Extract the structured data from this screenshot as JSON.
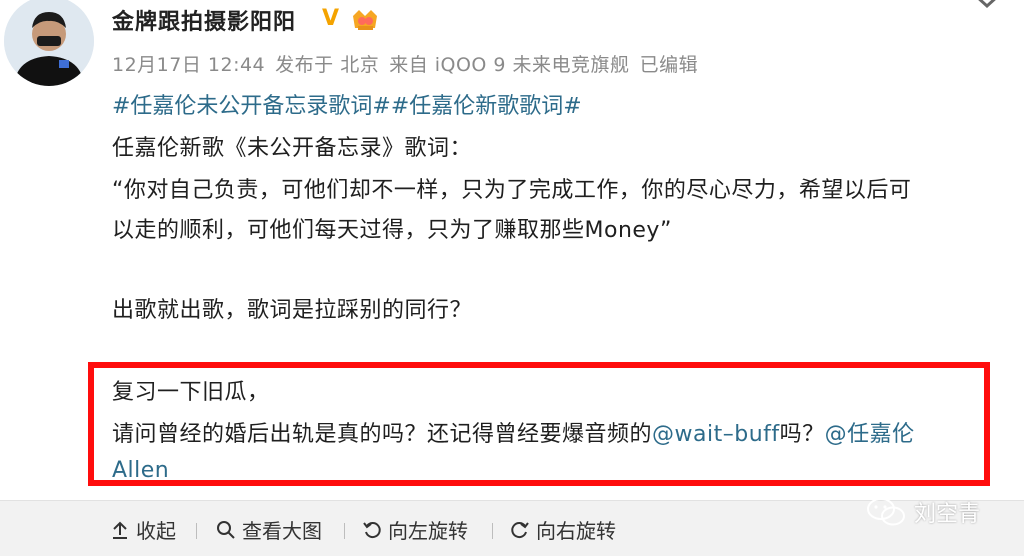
{
  "post": {
    "username": "金牌跟拍摄影阳阳",
    "verified_badge": "V",
    "meta": {
      "date": "12月17日 12:44",
      "location": "发布于 北京",
      "device": "来自 iQOO 9 未来电竞旗舰",
      "edited": "已编辑"
    },
    "topics": "#任嘉伦未公开备忘录歌词##任嘉伦新歌歌词#",
    "lines": {
      "l1": "任嘉伦新歌《未公开备忘录》歌词：",
      "l2": "“你对自己负责，可他们却不一样，只为了完成工作，你的尽心尽力，希望以后可",
      "l3": "以走的顺利，可他们每天过得，只为了赚取那些Money”",
      "l4": "出歌就出歌，歌词是拉踩别的同行？",
      "l5": "复习一下旧瓜，",
      "l6_text": "请问曾经的婚后出轨是真的吗？还记得曾经要爆音频的",
      "l6_mention1": "@wait–buff",
      "l6_text2": "吗？",
      "l6_mention2": "@任嘉伦",
      "l7": "Allen"
    }
  },
  "toolbar": {
    "collapse": "收起",
    "view_large": "查看大图",
    "rotate_left": "向左旋转",
    "rotate_right": "向右旋转"
  },
  "watermark": "刘空青",
  "colors": {
    "link": "#2d6b8a",
    "highlight_border": "#ff0d0d",
    "verified": "#f4a300"
  }
}
